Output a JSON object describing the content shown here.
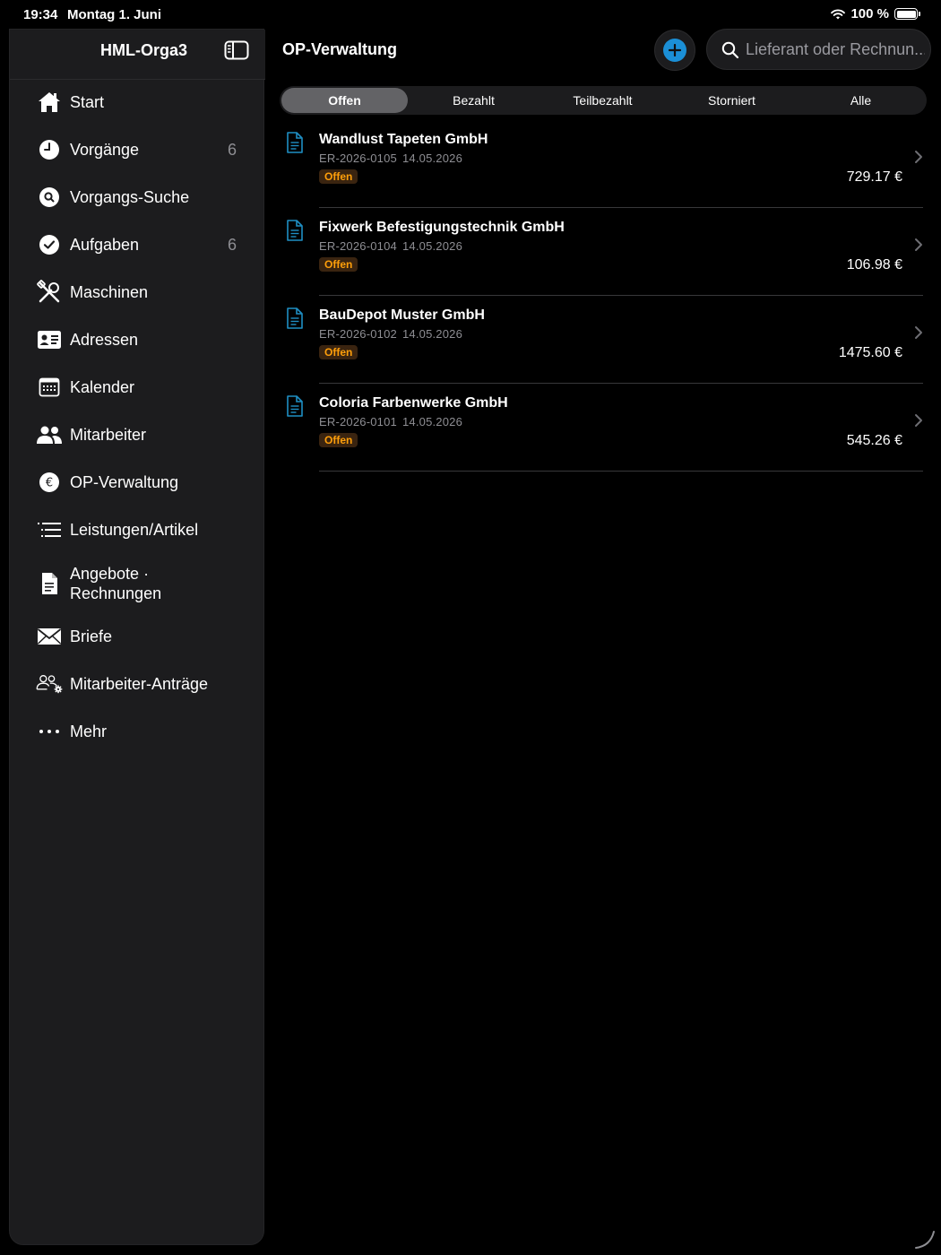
{
  "status_bar": {
    "time": "19:34",
    "date": "Montag 1. Juni",
    "battery": "100 %"
  },
  "sidebar": {
    "app_title": "HML-Orga3",
    "items": [
      {
        "label": "Start",
        "icon": "house-icon",
        "count": ""
      },
      {
        "label": "Vorgänge",
        "icon": "clock-icon",
        "count": "6"
      },
      {
        "label": "Vorgangs-Suche",
        "icon": "search-circle-icon",
        "count": ""
      },
      {
        "label": "Aufgaben",
        "icon": "checkmark-circle-icon",
        "count": "6"
      },
      {
        "label": "Maschinen",
        "icon": "tools-icon",
        "count": ""
      },
      {
        "label": "Adressen",
        "icon": "contact-card-icon",
        "count": ""
      },
      {
        "label": "Kalender",
        "icon": "calendar-icon",
        "count": ""
      },
      {
        "label": "Mitarbeiter",
        "icon": "people-icon",
        "count": ""
      },
      {
        "label": "OP-Verwaltung",
        "icon": "euro-circle-icon",
        "count": ""
      },
      {
        "label": "Leistungen/Artikel",
        "icon": "list-icon",
        "count": ""
      },
      {
        "label": "Angebote · Rechnungen",
        "icon": "document-icon",
        "count": ""
      },
      {
        "label": "Briefe",
        "icon": "envelope-icon",
        "count": ""
      },
      {
        "label": "Mitarbeiter-Anträge",
        "icon": "people-gear-icon",
        "count": ""
      },
      {
        "label": "Mehr",
        "icon": "ellipsis-icon",
        "count": ""
      }
    ]
  },
  "header": {
    "title": "OP-Verwaltung",
    "search_placeholder": "Lieferant oder Rechnun..."
  },
  "segments": [
    "Offen",
    "Bezahlt",
    "Teilbezahlt",
    "Storniert",
    "Alle"
  ],
  "active_segment": "Offen",
  "invoices": [
    {
      "vendor": "Wandlust Tapeten GmbH",
      "number": "ER-2026-0105",
      "date": "14.05.2026",
      "status": "Offen",
      "amount": "729.17 €"
    },
    {
      "vendor": "Fixwerk Befestigungstechnik GmbH",
      "number": "ER-2026-0104",
      "date": "14.05.2026",
      "status": "Offen",
      "amount": "106.98 €"
    },
    {
      "vendor": "BauDepot Muster GmbH",
      "number": "ER-2026-0102",
      "date": "14.05.2026",
      "status": "Offen",
      "amount": "1475.60 €"
    },
    {
      "vendor": "Coloria Farbenwerke GmbH",
      "number": "ER-2026-0101",
      "date": "14.05.2026",
      "status": "Offen",
      "amount": "545.26 €"
    }
  ],
  "colors": {
    "accent": "#1b8fd6",
    "doc_icon": "#1f8fc4",
    "badge_text": "#ff9f0a",
    "badge_bg": "#3a2410",
    "sidebar_bg": "#1c1c1e"
  }
}
